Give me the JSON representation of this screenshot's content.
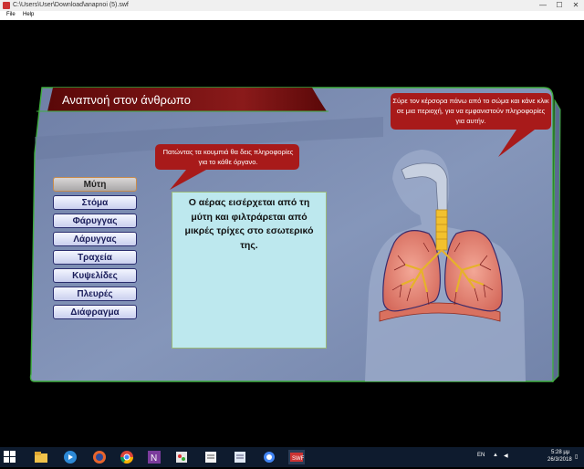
{
  "window": {
    "title": "C:\\Users\\User\\Download\\anapnoi (5).swf",
    "minimize": "—",
    "maximize": "☐",
    "close": "✕"
  },
  "menu": {
    "file": "File",
    "help": "Help"
  },
  "app": {
    "title": "Αναπνοή στον άνθρωπο",
    "hint_buttons": "Πατώντας τα κουμπιά θα δεις πληροφορίες για το κάθε όργανο.",
    "hint_body": "Σύρε τον κέρσορα πάνω από το σώμα και κάνε κλικ σε μια περιοχή, για να εμφανιστούν πληροφορίες για αυτήν.",
    "organs": [
      "Μύτη",
      "Στόμα",
      "Φάρυγγας",
      "Λάρυγγας",
      "Τραχεία",
      "Κυψελίδες",
      "Πλευρές",
      "Διάφραγμα"
    ],
    "selected_organ": "Μύτη",
    "info_text": "Ο αέρας εισέρχεται από τη μύτη και φιλτράρεται από μικρές τρίχες στο εσωτερικό της."
  },
  "taskbar": {
    "language": "EN",
    "time": "5:28 μμ",
    "date": "26/3/2018",
    "icons": [
      "start-icon",
      "file-explorer-icon",
      "media-player-icon",
      "firefox-icon",
      "chrome-icon",
      "onenote-icon",
      "paint-icon",
      "notes-icon",
      "chrome-app-icon",
      "swf-player-icon"
    ]
  },
  "colors": {
    "panel": "#8393b5",
    "panel_light": "#9aaac8",
    "banner": "#6e1010",
    "bubble": "#a81a1a",
    "info_box": "#bde8ee",
    "button_face": "#dde2fa",
    "lung": "#e8897a",
    "trachea": "#f2c12e"
  }
}
